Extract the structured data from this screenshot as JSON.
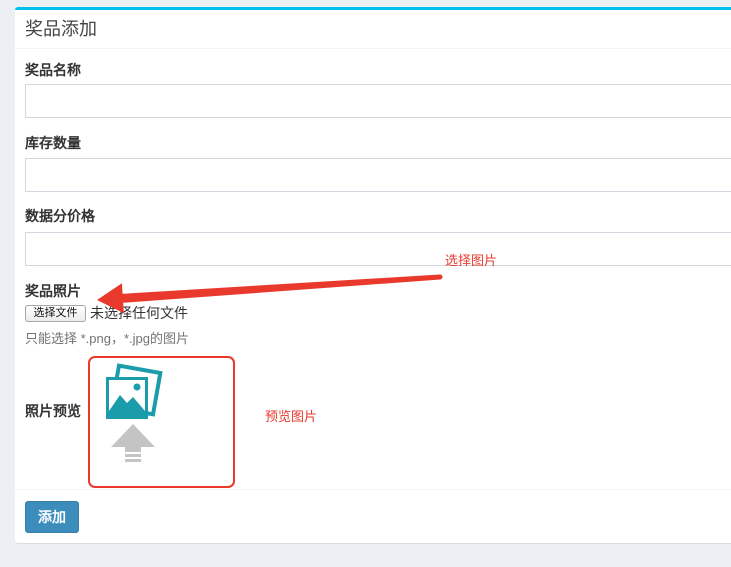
{
  "theme": {
    "page_background": "#ecf0f5",
    "accent": "#00c0ef",
    "primary_button": "#3c8dbc",
    "primary_button_border": "#367fa9",
    "annotation_red": "#e8392c",
    "icon_teal": "#1a9cab",
    "icon_grey": "#c4c4c4"
  },
  "panel": {
    "title": "奖品添加"
  },
  "form": {
    "prize_name": {
      "label": "奖品名称",
      "value": ""
    },
    "stock_quantity": {
      "label": "库存数量",
      "value": ""
    },
    "data_points_price": {
      "label": "数据分价格",
      "value": ""
    },
    "prize_photo": {
      "label": "奖品照片",
      "choose_file_label": "选择文件",
      "file_status": "未选择任何文件",
      "help_text": "只能选择 *.png，*.jpg的图片"
    },
    "photo_preview": {
      "label": "照片预览",
      "icon": "image-upload-icon"
    }
  },
  "footer": {
    "submit_label": "添加"
  },
  "annotations": {
    "select_image_note": "选择图片",
    "preview_image_note": "预览图片"
  }
}
